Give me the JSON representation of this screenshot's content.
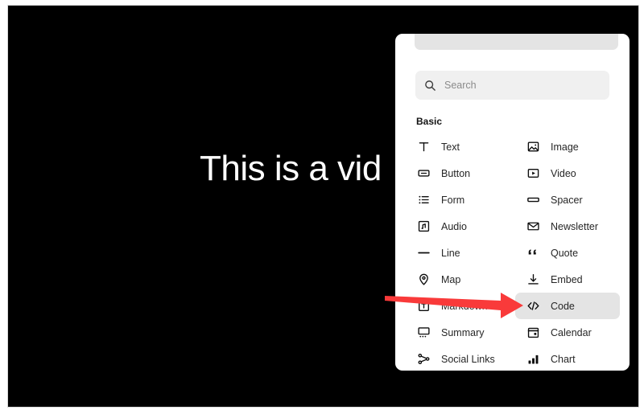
{
  "canvas": {
    "text": "This is a vid",
    "background_color": "#000000",
    "text_color": "#ffffff"
  },
  "panel": {
    "search": {
      "placeholder": "Search",
      "value": "",
      "icon": "search-icon"
    },
    "group_label": "Basic",
    "selected_item": "Code",
    "highlight_color": "#e4e4e4",
    "items": [
      {
        "label": "Text",
        "icon": "text-icon",
        "column": "left",
        "selected": false
      },
      {
        "label": "Image",
        "icon": "image-icon",
        "column": "right",
        "selected": false
      },
      {
        "label": "Button",
        "icon": "button-icon",
        "column": "left",
        "selected": false
      },
      {
        "label": "Video",
        "icon": "video-icon",
        "column": "right",
        "selected": false
      },
      {
        "label": "Form",
        "icon": "form-icon",
        "column": "left",
        "selected": false
      },
      {
        "label": "Spacer",
        "icon": "spacer-icon",
        "column": "right",
        "selected": false
      },
      {
        "label": "Audio",
        "icon": "audio-icon",
        "column": "left",
        "selected": false
      },
      {
        "label": "Newsletter",
        "icon": "newsletter-icon",
        "column": "right",
        "selected": false
      },
      {
        "label": "Line",
        "icon": "line-icon",
        "column": "left",
        "selected": false
      },
      {
        "label": "Quote",
        "icon": "quote-icon",
        "column": "right",
        "selected": false
      },
      {
        "label": "Map",
        "icon": "map-pin-icon",
        "column": "left",
        "selected": false
      },
      {
        "label": "Embed",
        "icon": "embed-icon",
        "column": "right",
        "selected": false
      },
      {
        "label": "Markdown",
        "icon": "markdown-icon",
        "column": "left",
        "selected": false
      },
      {
        "label": "Code",
        "icon": "code-icon",
        "column": "right",
        "selected": true
      },
      {
        "label": "Summary",
        "icon": "summary-icon",
        "column": "left",
        "selected": false
      },
      {
        "label": "Calendar",
        "icon": "calendar-icon",
        "column": "right",
        "selected": false
      },
      {
        "label": "Social Links",
        "icon": "social-links-icon",
        "column": "left",
        "selected": false
      },
      {
        "label": "Chart",
        "icon": "chart-icon",
        "column": "right",
        "selected": false
      }
    ]
  },
  "annotation": {
    "arrow_color": "#f93a3a",
    "points_to": "Code"
  }
}
